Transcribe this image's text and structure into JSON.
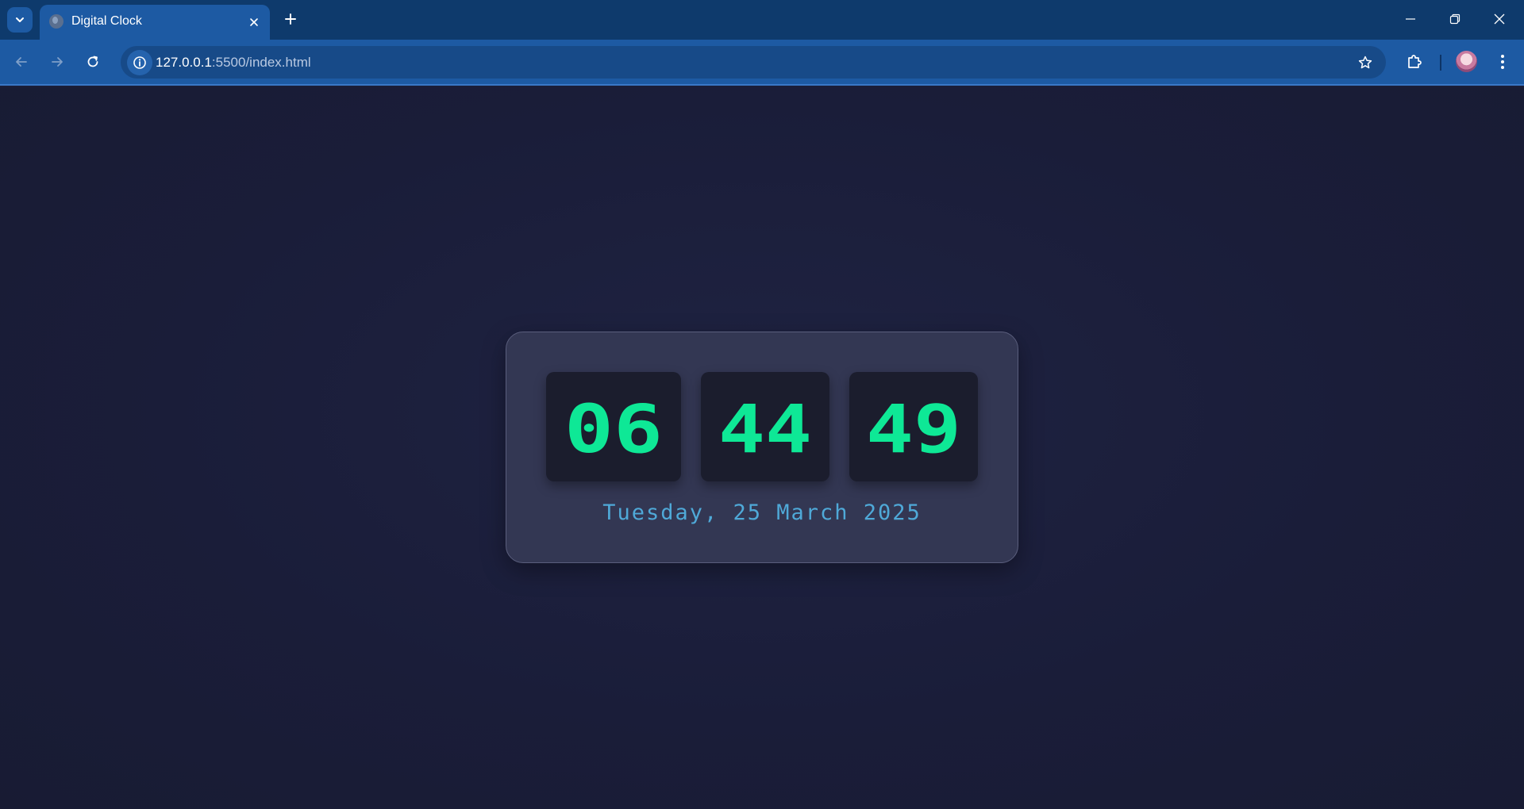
{
  "browser": {
    "tab_title": "Digital Clock",
    "url_host": "127.0.0.1",
    "url_path": ":5500/index.html",
    "accent": "#1d5aa3"
  },
  "clock": {
    "hours": "06",
    "minutes": "44",
    "seconds": "49",
    "date": "Tuesday, 25 March 2025",
    "digit_color": "#0ee896",
    "date_color": "#4fa9d8"
  },
  "icons": {
    "tab_search": "chevron-down-icon",
    "favicon": "globe-icon",
    "tab_close": "close-icon",
    "new_tab": "plus-icon",
    "back": "arrow-left-icon",
    "forward": "arrow-right-icon",
    "reload": "reload-icon",
    "site_info": "info-icon",
    "bookmark": "star-icon",
    "extensions": "puzzle-icon",
    "menu": "kebab-menu-icon",
    "minimize": "minimize-icon",
    "restore": "restore-icon",
    "close_window": "close-icon"
  }
}
